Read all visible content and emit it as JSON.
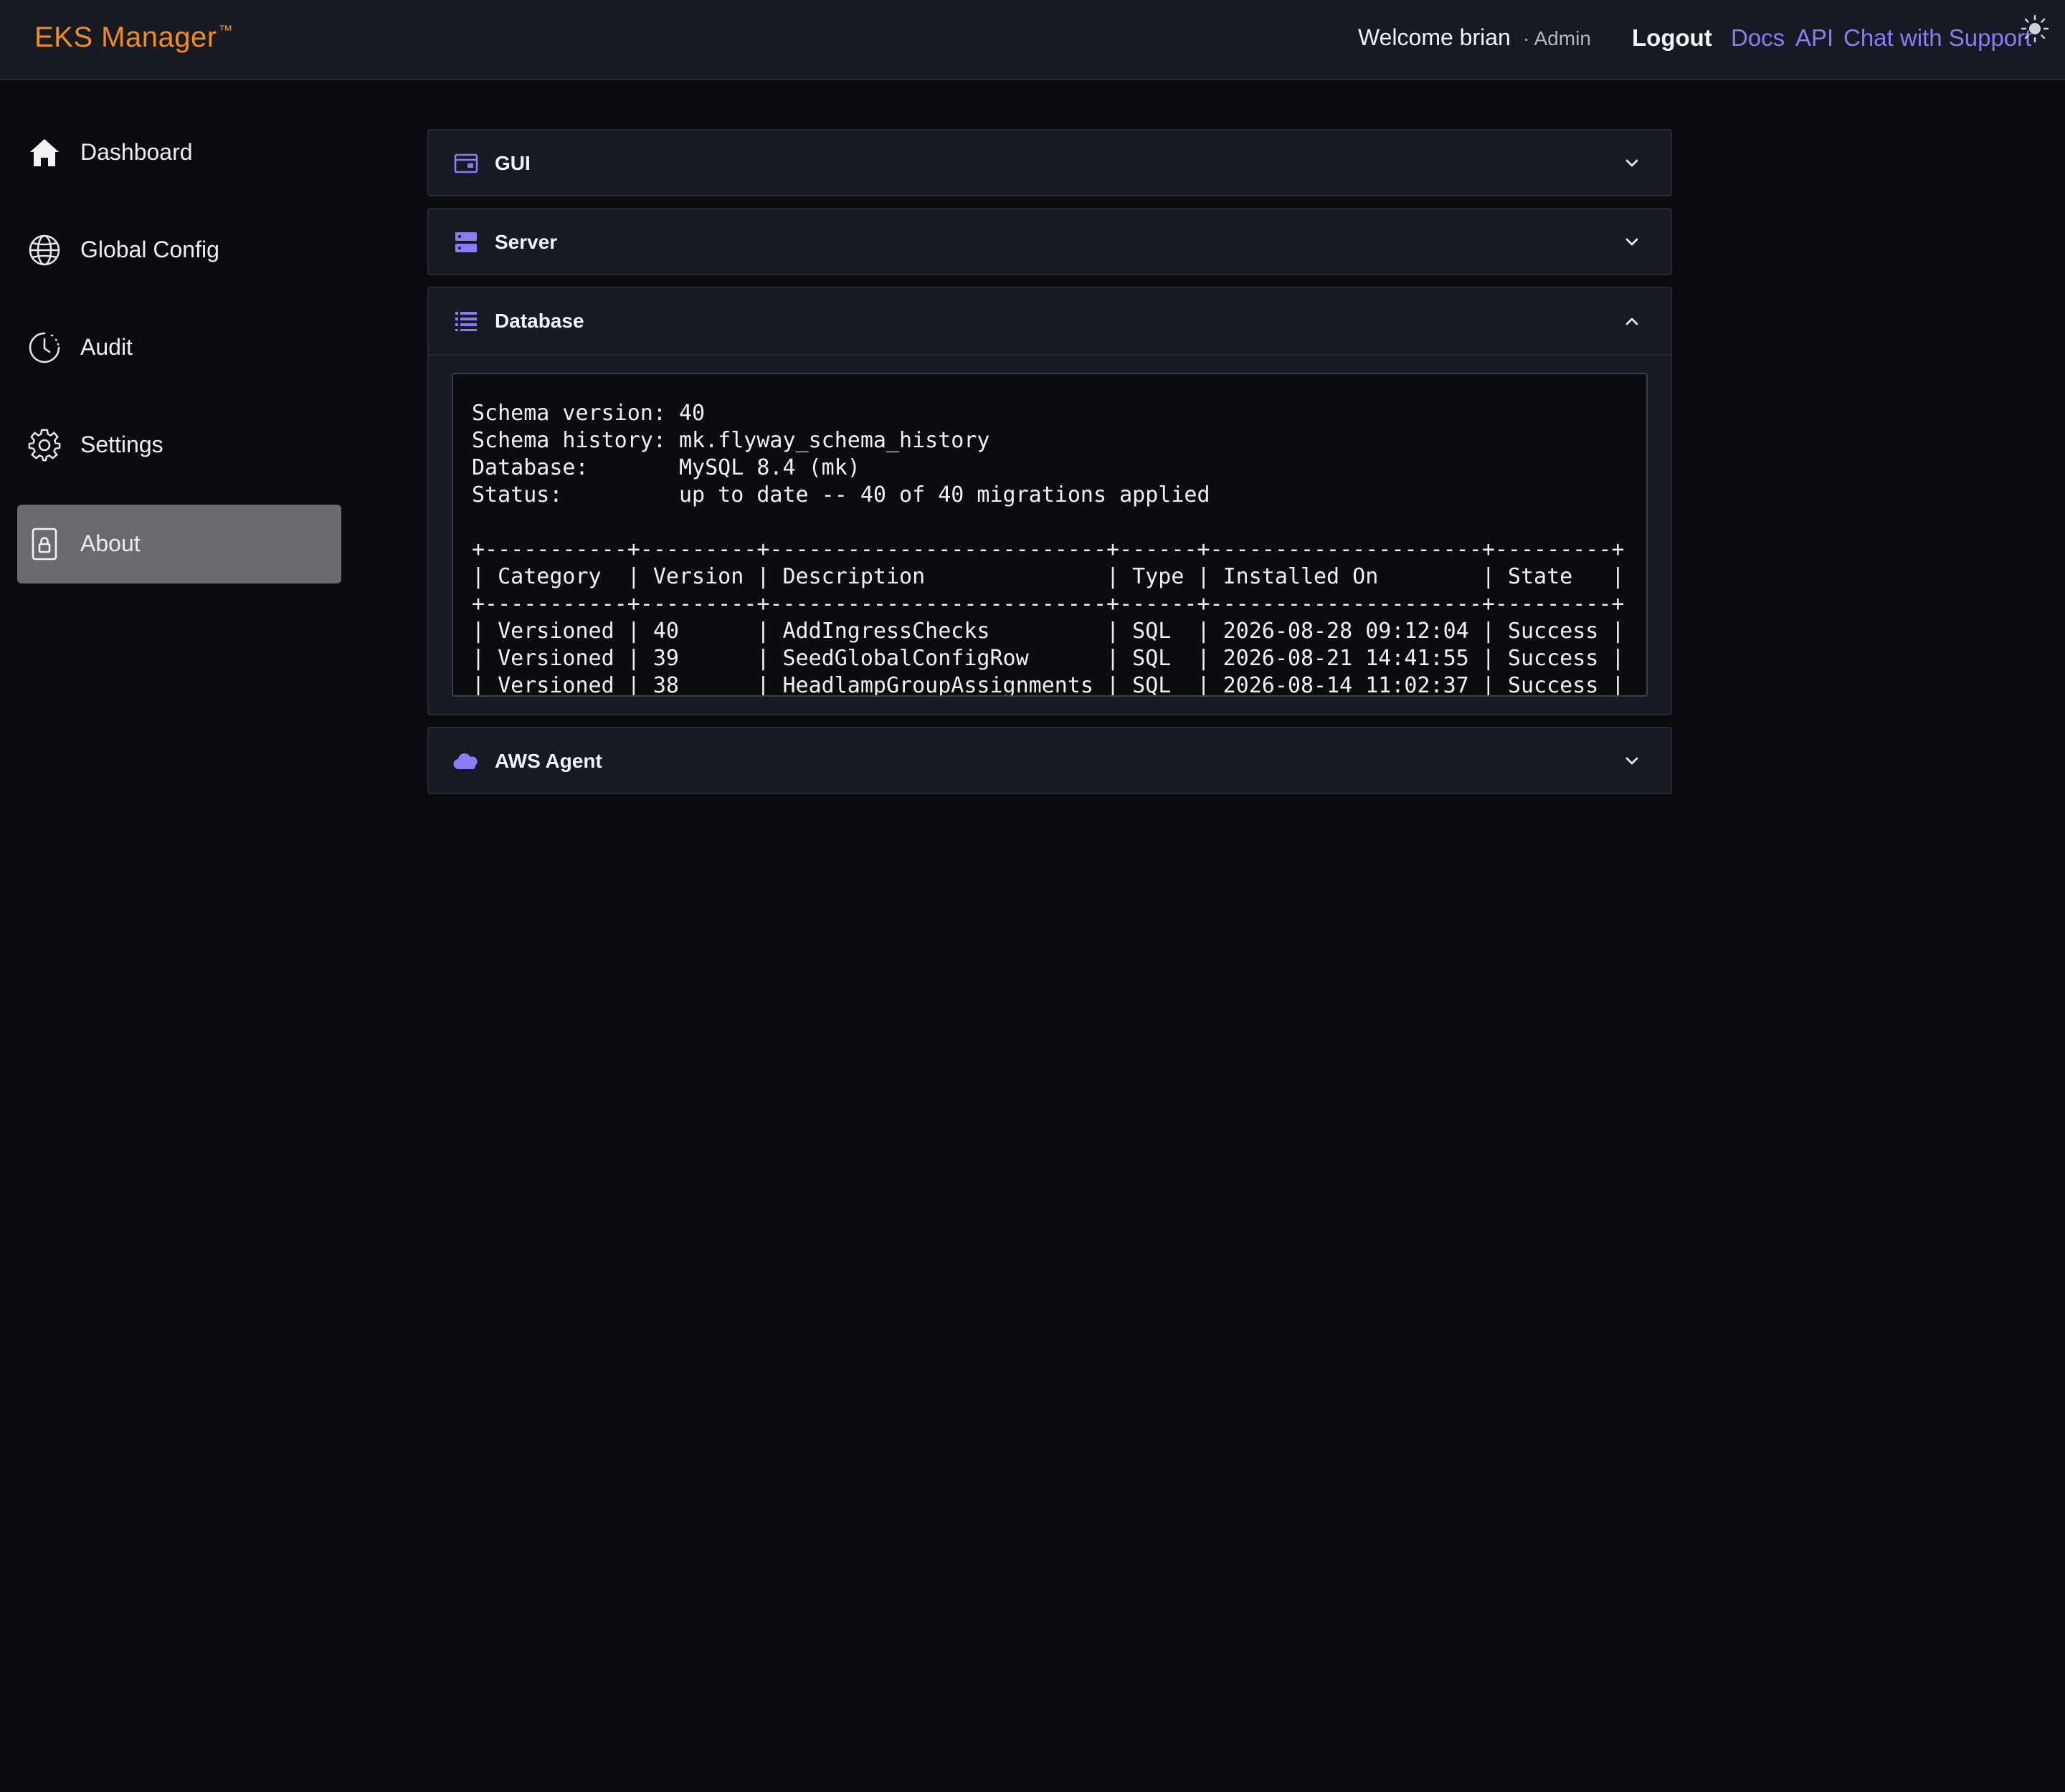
{
  "header": {
    "brand": "EKS Manager",
    "brand_mark": "™",
    "welcome": "Welcome brian",
    "role": "· Admin",
    "logout": "Logout",
    "links": {
      "docs": "Docs",
      "api": "API",
      "chat": "Chat with Support"
    },
    "theme_icon": "sun-icon"
  },
  "sidebar": {
    "items": [
      {
        "label": "Dashboard",
        "icon": "home-icon"
      },
      {
        "label": "Global Config",
        "icon": "globe-icon"
      },
      {
        "label": "Audit",
        "icon": "clock-icon"
      },
      {
        "label": "Settings",
        "icon": "gear-icon"
      },
      {
        "label": "About",
        "icon": "lock-icon",
        "active": true
      }
    ]
  },
  "accordion": {
    "gui": {
      "title": "GUI",
      "expanded": false
    },
    "server": {
      "title": "Server",
      "expanded": false
    },
    "database": {
      "title": "Database",
      "expanded": true,
      "console_lines": [
        "Schema version: 40",
        "Schema history: mk.flyway_schema_history",
        "Database:       MySQL 8.4 (mk)",
        "Status:         up to date -- 40 of 40 migrations applied",
        "",
        "+-----------+---------+--------------------------+------+---------------------+---------+",
        "| Category  | Version | Description              | Type | Installed On        | State   |",
        "+-----------+---------+--------------------------+------+---------------------+---------+",
        "| Versioned | 40      | AddIngressChecks         | SQL  | 2026-08-28 09:12:04 | Success |",
        "| Versioned | 39      | SeedGlobalConfigRow      | SQL  | 2026-08-21 14:41:55 | Success |",
        "| Versioned | 38      | HeadlampGroupAssignments | SQL  | 2026-08-14 11:02:37 | Success |"
      ]
    },
    "aws_agent": {
      "title": "AWS Agent",
      "expanded": false
    }
  },
  "colors": {
    "accent": "#8b7cf6",
    "brand": "#f28c1c",
    "active_nav": "#6a6b6e"
  }
}
